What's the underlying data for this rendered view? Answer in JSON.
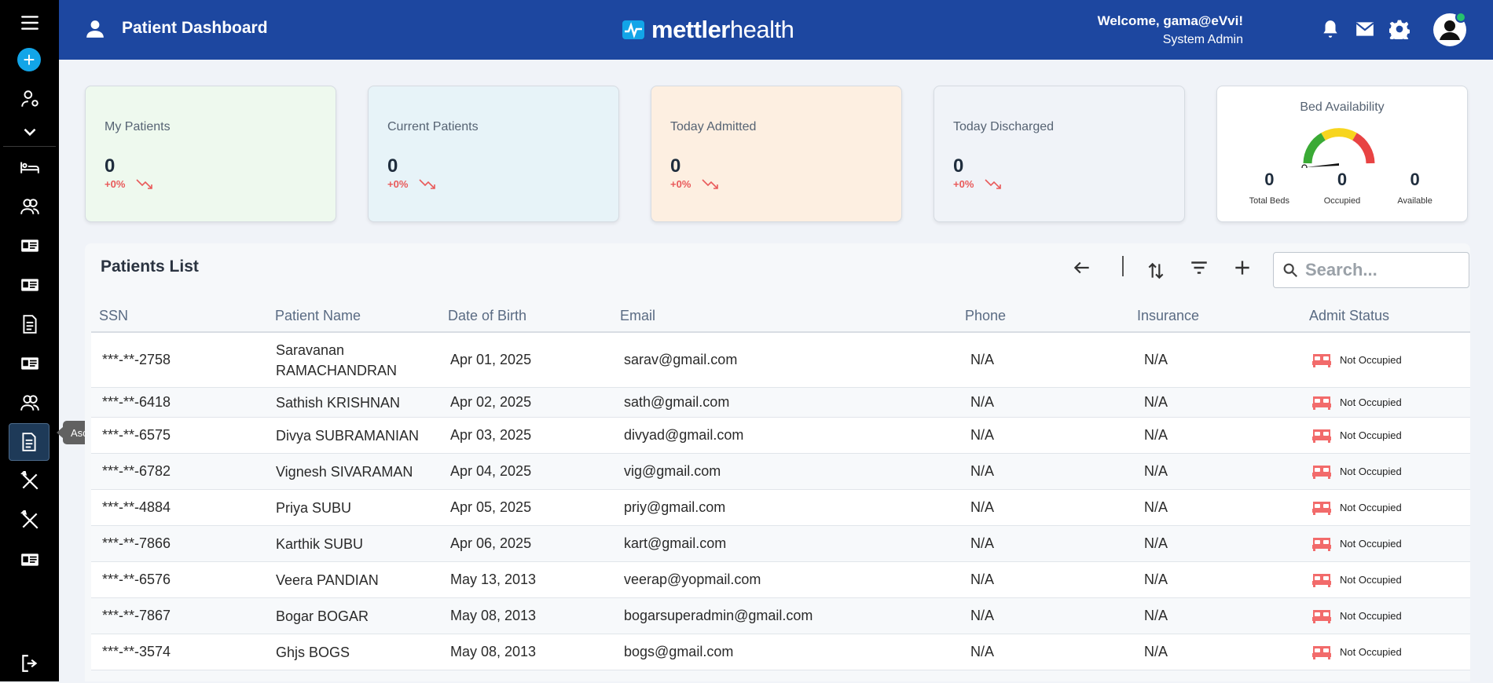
{
  "header": {
    "title": "Patient Dashboard",
    "logo_bold": "mettler",
    "logo_light": "health",
    "welcome": "Welcome, gama@eVvi!",
    "role": "System Admin"
  },
  "sidebar": {
    "tooltip": "Ascension Audio Config",
    "items": [
      "menu-icon",
      "add-icon",
      "user-settings-icon",
      "chevron-down-icon",
      "bed-icon",
      "users-icon",
      "id-card-icon",
      "id-card-icon",
      "document-icon",
      "id-card-icon",
      "users-icon",
      "document-icon",
      "tools-icon",
      "tools-icon",
      "id-card-icon",
      "logout-icon"
    ]
  },
  "cards": [
    {
      "label": "My Patients",
      "value": "0",
      "change": "+0%",
      "bg": "#eef9ee"
    },
    {
      "label": "Current Patients",
      "value": "0",
      "change": "+0%",
      "bg": "#e7f3f8"
    },
    {
      "label": "Today Admitted",
      "value": "0",
      "change": "+0%",
      "bg": "#fdefe1"
    },
    {
      "label": "Today Discharged",
      "value": "0",
      "change": "+0%",
      "bg": "#f0f3f8"
    }
  ],
  "bed_availability": {
    "title": "Bed Availability",
    "total": "0",
    "total_label": "Total Beds",
    "occupied": "0",
    "occupied_label": "Occupied",
    "available": "0",
    "available_label": "Available"
  },
  "patients": {
    "title": "Patients List",
    "search_placeholder": "Search...",
    "columns": [
      "SSN",
      "Patient Name",
      "Date of Birth",
      "Email",
      "Phone",
      "Insurance",
      "Admit Status"
    ],
    "rows": [
      {
        "ssn": "***-**-2758",
        "name": "Saravanan RAMACHANDRAN",
        "dob": "Apr 01, 2025",
        "email": "sarav@gmail.com",
        "phone": "N/A",
        "insurance": "N/A",
        "status": "Not Occupied"
      },
      {
        "ssn": "***-**-6418",
        "name": "Sathish KRISHNAN",
        "dob": "Apr 02, 2025",
        "email": "sath@gmail.com",
        "phone": "N/A",
        "insurance": "N/A",
        "status": "Not Occupied"
      },
      {
        "ssn": "***-**-6575",
        "name": "Divya SUBRAMANIAN",
        "dob": "Apr 03, 2025",
        "email": "divyad@gmail.com",
        "phone": "N/A",
        "insurance": "N/A",
        "status": "Not Occupied"
      },
      {
        "ssn": "***-**-6782",
        "name": "Vignesh SIVARAMAN",
        "dob": "Apr 04, 2025",
        "email": "vig@gmail.com",
        "phone": "N/A",
        "insurance": "N/A",
        "status": "Not Occupied"
      },
      {
        "ssn": "***-**-4884",
        "name": "Priya SUBU",
        "dob": "Apr 05, 2025",
        "email": "priy@gmail.com",
        "phone": "N/A",
        "insurance": "N/A",
        "status": "Not Occupied"
      },
      {
        "ssn": "***-**-7866",
        "name": "Karthik SUBU",
        "dob": "Apr 06, 2025",
        "email": "kart@gmail.com",
        "phone": "N/A",
        "insurance": "N/A",
        "status": "Not Occupied"
      },
      {
        "ssn": "***-**-6576",
        "name": "Veera PANDIAN",
        "dob": "May 13, 2013",
        "email": "veerap@yopmail.com",
        "phone": "N/A",
        "insurance": "N/A",
        "status": "Not Occupied"
      },
      {
        "ssn": "***-**-7867",
        "name": "Bogar BOGAR",
        "dob": "May 08, 2013",
        "email": "bogarsuperadmin@gmail.com",
        "phone": "N/A",
        "insurance": "N/A",
        "status": "Not Occupied"
      },
      {
        "ssn": "***-**-3574",
        "name": "Ghjs BOGS",
        "dob": "May 08, 2013",
        "email": "bogs@gmail.com",
        "phone": "N/A",
        "insurance": "N/A",
        "status": "Not Occupied"
      }
    ]
  },
  "colors": {
    "header": "#1d47a0",
    "sidebar": "#000000",
    "accent": "#12a5e8",
    "bed_icon": "#f26b6b",
    "change": "#e95a5a"
  }
}
